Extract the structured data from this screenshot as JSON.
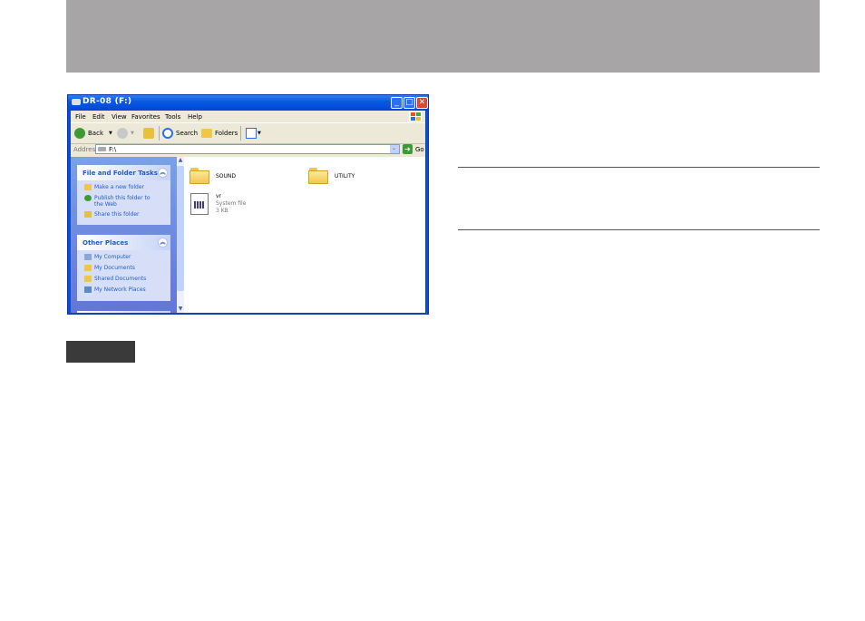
{
  "window": {
    "title": "DR-08 (F:)",
    "minimize": "_",
    "maximize": "□",
    "close": "✕"
  },
  "menu": [
    "File",
    "Edit",
    "View",
    "Favorites",
    "Tools",
    "Help"
  ],
  "toolbar": {
    "back_label": "Back",
    "search_label": "Search",
    "folders_label": "Folders"
  },
  "address": {
    "label": "Address",
    "value": "F:\\",
    "go_label": "Go"
  },
  "tasks_panel": {
    "title": "File and Folder Tasks",
    "links": [
      "Make a new folder",
      "Publish this folder to the Web",
      "Share this folder"
    ]
  },
  "places_panel": {
    "title": "Other Places",
    "links": [
      "My Computer",
      "My Documents",
      "Shared Documents",
      "My Network Places"
    ]
  },
  "files": [
    {
      "name": "SOUND",
      "type": "folder"
    },
    {
      "name": "UTILITY",
      "type": "folder"
    },
    {
      "name": "vr",
      "type": "System file",
      "size": "3 KB"
    }
  ],
  "colors": {
    "titlebar": "#0a5ae0",
    "sidepane": "#7aa1e6",
    "link": "#215dc6",
    "page_header": "#a7a5a5"
  }
}
